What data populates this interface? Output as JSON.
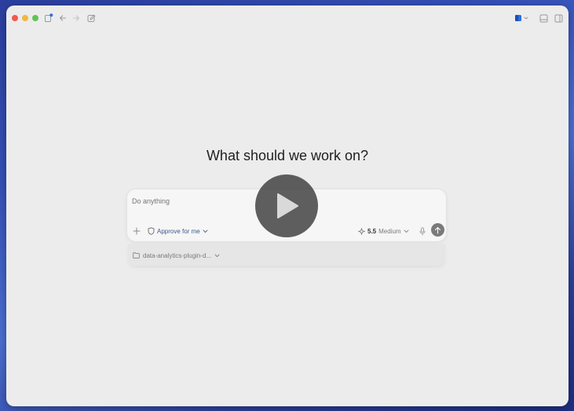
{
  "main": {
    "heading": "What should we work on?"
  },
  "composer": {
    "placeholder": "Do anything",
    "approval_label": "Approve for me",
    "model_version": "5.5",
    "model_effort": "Medium"
  },
  "project": {
    "label": "data-analytics-plugin-d..."
  },
  "icons": {
    "sidebar": "sidebar-toggle-icon",
    "back": "arrow-left-icon",
    "forward": "arrow-right-icon",
    "new_chat": "compose-icon",
    "app_switch": "app-switcher-icon",
    "panel_bottom": "bottom-panel-icon",
    "panel_right": "right-panel-icon",
    "play": "play-icon"
  },
  "colors": {
    "close": "#ee5a52",
    "minimize": "#f2b73f",
    "maximize": "#5fc453",
    "send": "#7a7a7a",
    "approval_text": "#3a5a8c"
  }
}
